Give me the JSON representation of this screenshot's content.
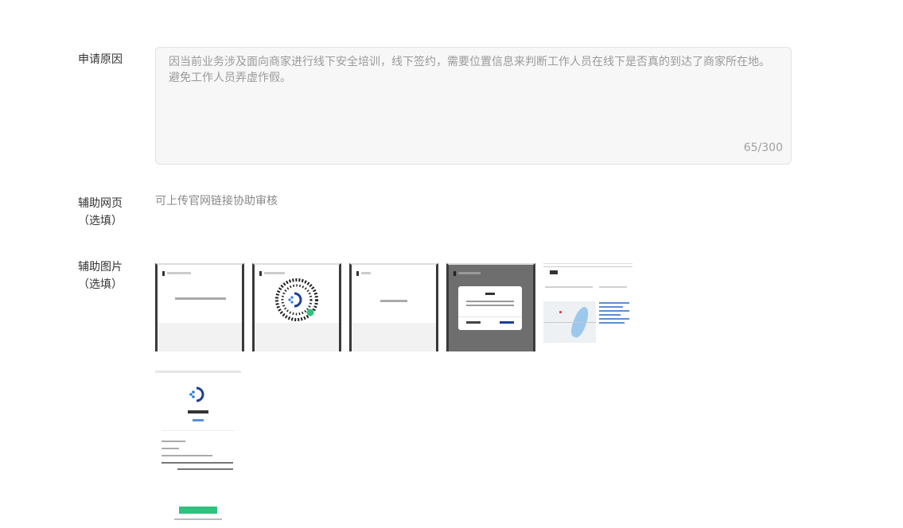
{
  "reason": {
    "label": "申请原因",
    "text": "因当前业务涉及面向商家进行线下安全培训，线下签约，需要位置信息来判断工作人员在线下是否真的到达了商家所在地。避免工作人员弄虚作假。",
    "counter": "65/300"
  },
  "web": {
    "label_line1": "辅助网页",
    "label_line2": "（选填）",
    "hint": "可上传官网链接协助审核"
  },
  "images": {
    "label_line1": "辅助图片",
    "label_line2": "（选填）",
    "thumb_count": 6
  },
  "colors": {
    "accent": "#1c3f94",
    "success": "#2ec27e",
    "border": "#e3e3e3"
  }
}
